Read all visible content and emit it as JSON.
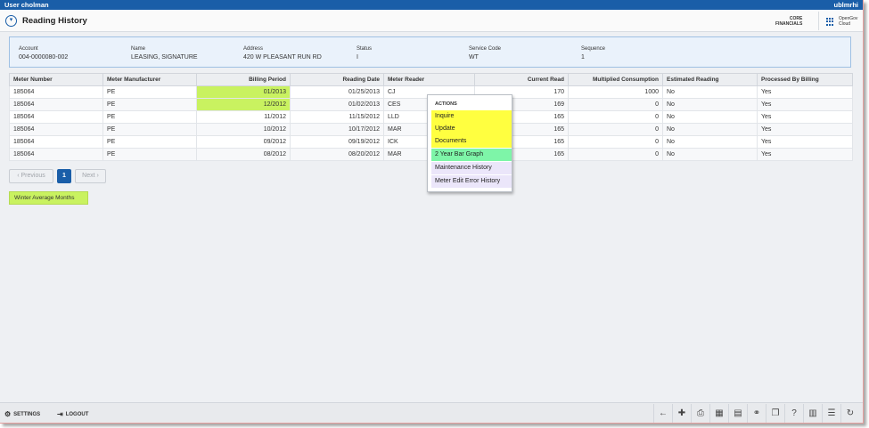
{
  "topbar": {
    "user": "User cholman",
    "instance": "ublmrhi"
  },
  "header": {
    "title": "Reading History",
    "product_line1": "CORE",
    "product_line2": "FINANCIALS",
    "brand_line1": "OpenGov",
    "brand_line2": "Cloud"
  },
  "account_info": {
    "account_label": "Account",
    "account_value": "004-0000080-002",
    "name_label": "Name",
    "name_value": "LEASING, SIGNATURE",
    "address_label": "Address",
    "address_value": "420 W PLEASANT RUN RD",
    "status_label": "Status",
    "status_value": "I",
    "service_code_label": "Service Code",
    "service_code_value": "WT",
    "sequence_label": "Sequence",
    "sequence_value": "1"
  },
  "table": {
    "columns": [
      "Meter Number",
      "Meter Manufacturer",
      "Billing Period",
      "Reading Date",
      "Meter Reader",
      "Current Read",
      "Multiplied Consumption",
      "Estimated Reading",
      "Processed By Billing"
    ],
    "rows": [
      [
        "185064",
        "PE",
        "01/2013",
        "01/25/2013",
        "CJ",
        "170",
        "1000",
        "No",
        "Yes"
      ],
      [
        "185064",
        "PE",
        "12/2012",
        "01/02/2013",
        "CES",
        "169",
        "0",
        "No",
        "Yes"
      ],
      [
        "185064",
        "PE",
        "11/2012",
        "11/15/2012",
        "LLD",
        "165",
        "0",
        "No",
        "Yes"
      ],
      [
        "185064",
        "PE",
        "10/2012",
        "10/17/2012",
        "MAR",
        "165",
        "0",
        "No",
        "Yes"
      ],
      [
        "185064",
        "PE",
        "09/2012",
        "09/19/2012",
        "ICK",
        "165",
        "0",
        "No",
        "Yes"
      ],
      [
        "185064",
        "PE",
        "08/2012",
        "08/20/2012",
        "MAR",
        "165",
        "0",
        "No",
        "Yes"
      ]
    ],
    "highlight_color": "#c9f260"
  },
  "actions_menu": {
    "header": "ACTIONS",
    "items": [
      {
        "label": "Inquire",
        "color": "#ffff40"
      },
      {
        "label": "Update",
        "color": "#ffff40"
      },
      {
        "label": "Documents",
        "color": "#ffff40"
      },
      {
        "label": "2 Year Bar Graph",
        "color": "#7ef5a8"
      },
      {
        "label": "Maintenance History",
        "color": "#ebe6fa"
      },
      {
        "label": "Meter Edit Error History",
        "color": "#ebe6fa"
      }
    ]
  },
  "pagination": {
    "previous": "‹ Previous",
    "current": "1",
    "next": "Next ›"
  },
  "legend": {
    "label": "Winter Average Months"
  },
  "footer": {
    "settings": "SETTINGS",
    "logout": "LOGOUT",
    "tools": [
      "back-icon",
      "add-icon",
      "print-icon",
      "grid-view-icon",
      "export-icon",
      "binoculars-icon",
      "copy-icon",
      "help-icon",
      "calendar-icon",
      "hierarchy-icon",
      "refresh-icon"
    ]
  },
  "colors": {
    "topbar": "#1a5ea8",
    "info_panel": "#eaf2fb",
    "accent": "#1a5ea8"
  }
}
